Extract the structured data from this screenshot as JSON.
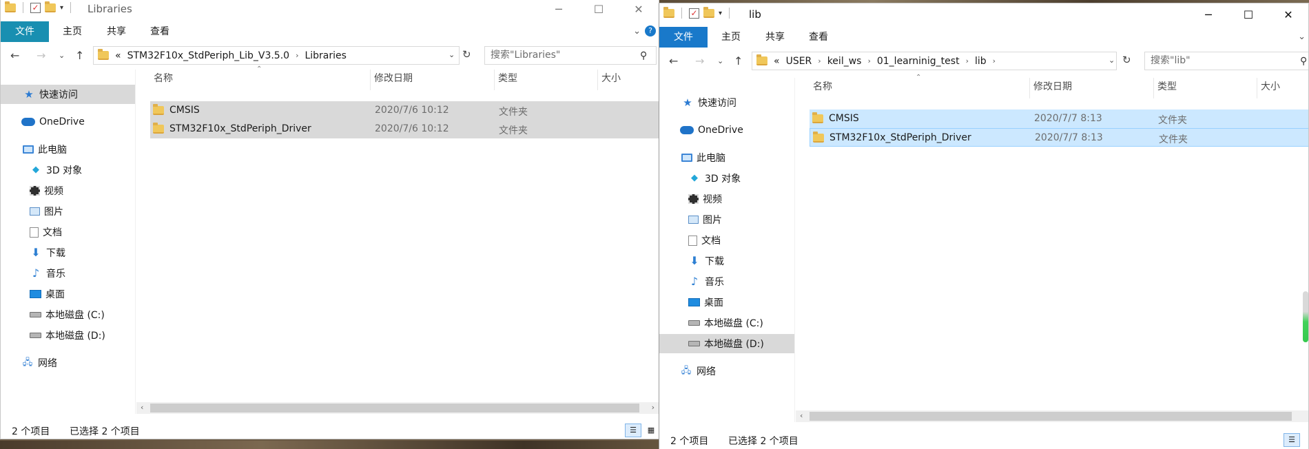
{
  "left_window": {
    "title": "Libraries",
    "ribbon": {
      "file": "文件",
      "home": "主页",
      "share": "共享",
      "view": "查看"
    },
    "address": {
      "overflow": "«",
      "crumbs": [
        "STM32F10x_StdPeriph_Lib_V3.5.0",
        "Libraries"
      ]
    },
    "search": {
      "placeholder": "搜索\"Libraries\""
    },
    "nav": {
      "quick_access": "快速访问",
      "onedrive": "OneDrive",
      "this_pc": "此电脑",
      "objects3d": "3D 对象",
      "videos": "视频",
      "pictures": "图片",
      "documents": "文档",
      "downloads": "下载",
      "music": "音乐",
      "desktop": "桌面",
      "drive_c": "本地磁盘 (C:)",
      "drive_d": "本地磁盘 (D:)",
      "network": "网络"
    },
    "columns": {
      "name": "名称",
      "date": "修改日期",
      "type": "类型",
      "size": "大小"
    },
    "files": [
      {
        "name": "CMSIS",
        "date": "2020/7/6 10:12",
        "type": "文件夹"
      },
      {
        "name": "STM32F10x_StdPeriph_Driver",
        "date": "2020/7/6 10:12",
        "type": "文件夹"
      }
    ],
    "status": {
      "count": "2 个项目",
      "selected": "已选择 2 个项目"
    }
  },
  "right_window": {
    "title": "lib",
    "ribbon": {
      "file": "文件",
      "home": "主页",
      "share": "共享",
      "view": "查看"
    },
    "address": {
      "overflow": "«",
      "crumbs": [
        "USER",
        "keil_ws",
        "01_learninig_test",
        "lib"
      ]
    },
    "search": {
      "placeholder": "搜索\"lib\""
    },
    "nav": {
      "quick_access": "快速访问",
      "onedrive": "OneDrive",
      "this_pc": "此电脑",
      "objects3d": "3D 对象",
      "videos": "视频",
      "pictures": "图片",
      "documents": "文档",
      "downloads": "下载",
      "music": "音乐",
      "desktop": "桌面",
      "drive_c": "本地磁盘 (C:)",
      "drive_d": "本地磁盘 (D:)",
      "network": "网络"
    },
    "columns": {
      "name": "名称",
      "date": "修改日期",
      "type": "类型",
      "size": "大小"
    },
    "files": [
      {
        "name": "CMSIS",
        "date": "2020/7/7 8:13",
        "type": "文件夹"
      },
      {
        "name": "STM32F10x_StdPeriph_Driver",
        "date": "2020/7/7 8:13",
        "type": "文件夹"
      }
    ],
    "status": {
      "count": "2 个项目",
      "selected": "已选择 2 个项目"
    }
  },
  "colors": {
    "file_tab_left": "#198fb1",
    "file_tab_right": "#1979ca",
    "selection_left": "#d9d9d9",
    "selection_right": "#cce8ff"
  }
}
